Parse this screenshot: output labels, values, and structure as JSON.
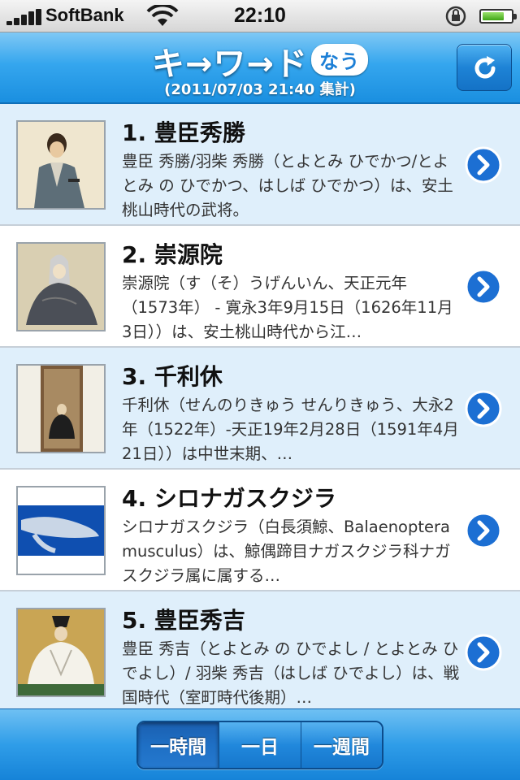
{
  "status_bar": {
    "carrier": "SoftBank",
    "time": "22:10"
  },
  "header": {
    "title": "キ→ワ→ド",
    "title_badge": "なう",
    "subtitle": "(2011/07/03 21:40 集計)",
    "refresh_icon": "refresh-icon"
  },
  "items": [
    {
      "title": "1. 豊臣秀勝",
      "description": "豊臣 秀勝/羽柴 秀勝（とよとみ ひでかつ/とよとみ の ひでかつ、はしば ひでかつ）は、安土桃山時代の武将。",
      "thumbnail": "portrait-samurai"
    },
    {
      "title": "2. 崇源院",
      "description": "崇源院（す（そ）うげんいん、天正元年（1573年） - 寛永3年9月15日（1626年11月3日））は、安土桃山時代から江…",
      "thumbnail": "portrait-nun"
    },
    {
      "title": "3. 千利休",
      "description": "千利休（せんのりきゅう せんりきゅう、大永2年（1522年）-天正19年2月28日（1591年4月21日））は中世末期、…",
      "thumbnail": "portrait-scroll"
    },
    {
      "title": "4. シロナガスクジラ",
      "description": "シロナガスクジラ（白長須鯨、Balaenoptera musculus）は、鯨偶蹄目ナガスクジラ科ナガスクジラ属に属する…",
      "thumbnail": "whale-photo"
    },
    {
      "title": "5. 豊臣秀吉",
      "description": "豊臣 秀吉（とよとみ の ひでよし / とよとみ ひでよし）/ 羽柴 秀吉（はしば ひでよし）は、戦国時代（室町時代後期）…",
      "thumbnail": "portrait-hideyoshi"
    }
  ],
  "toolbar": {
    "segments": [
      "一時間",
      "一日",
      "一週間"
    ],
    "selected": "一時間"
  },
  "colors": {
    "accent": "#1a8fe0",
    "row_alt": "#dfeffb",
    "disclosure": "#1c6fd3"
  }
}
